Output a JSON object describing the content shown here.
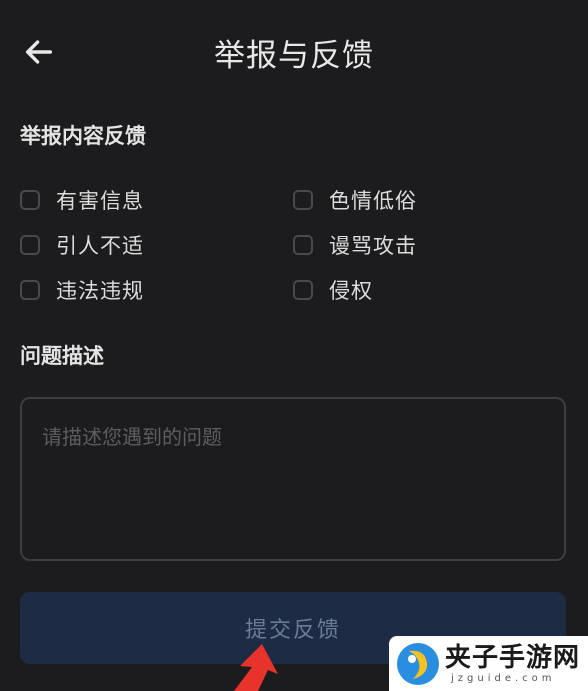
{
  "header": {
    "title": "举报与反馈",
    "back_icon": "arrow-left-icon"
  },
  "report": {
    "section_title": "举报内容反馈",
    "options": [
      {
        "label": "有害信息",
        "checked": false
      },
      {
        "label": "色情低俗",
        "checked": false
      },
      {
        "label": "引人不适",
        "checked": false
      },
      {
        "label": "谩骂攻击",
        "checked": false
      },
      {
        "label": "违法违规",
        "checked": false
      },
      {
        "label": "侵权",
        "checked": false
      }
    ]
  },
  "description": {
    "section_title": "问题描述",
    "placeholder": "请描述您遇到的问题",
    "value": ""
  },
  "submit": {
    "label": "提交反馈"
  },
  "watermark": {
    "name": "夹子手游网",
    "domain": "jzguide.com"
  },
  "colors": {
    "background": "#1c1c1e",
    "button": "#1e2b44",
    "annotation_arrow": "#e8322c"
  }
}
